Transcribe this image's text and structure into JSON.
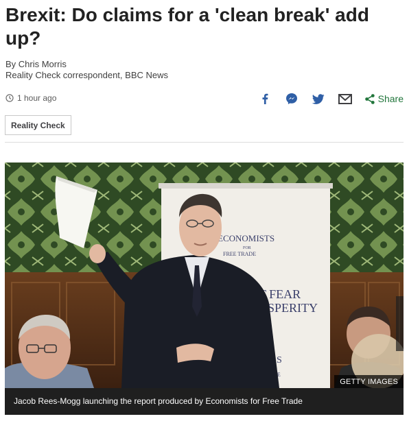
{
  "article": {
    "headline": "Brexit: Do claims for a 'clean break' add up?",
    "author": "By Chris Morris",
    "role": "Reality Check correspondent, BBC News",
    "timestamp": "1 hour ago",
    "tag": "Reality Check"
  },
  "share": {
    "icons": [
      "facebook-icon",
      "messenger-icon",
      "twitter-icon",
      "email-icon",
      "share-icon"
    ],
    "label": "Share",
    "color": "#22763c",
    "icon_color": "#2f5fa6"
  },
  "image": {
    "credit": "GETTY IMAGES",
    "caption": "Jacob Rees-Mogg launching the report produced by Economists for Free Trade",
    "banner_text_line1": "ECONOMISTS",
    "banner_text_line2": "FOR",
    "banner_text_line3": "FREE TRADE",
    "banner_text_line4": "T FEAR",
    "banner_text_line5": "OSPERITY",
    "banner_text_line6": "S",
    "banner_text_line7": "RADE"
  }
}
